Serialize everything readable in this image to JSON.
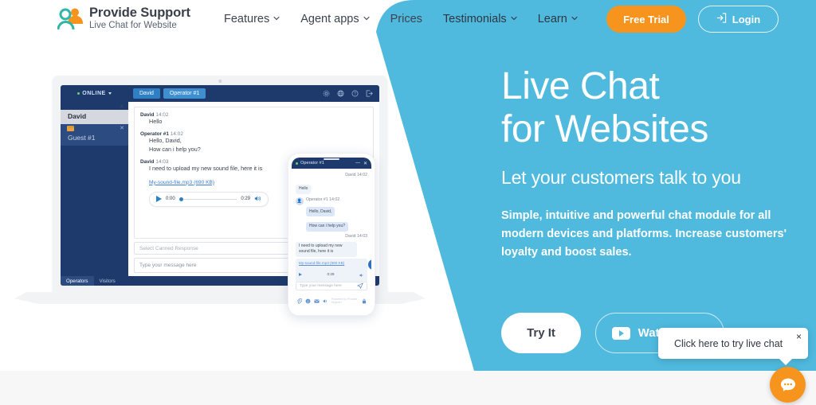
{
  "brand": {
    "name": "Provide Support",
    "tagline": "Live Chat for Website",
    "accent_orange": "#f7941e",
    "accent_blue": "#4fb9de",
    "dark_navy": "#1e3a6d"
  },
  "nav": {
    "items": [
      {
        "label": "Features",
        "has_caret": true
      },
      {
        "label": "Agent apps",
        "has_caret": true
      },
      {
        "label": "Prices",
        "has_caret": false
      },
      {
        "label": "Testimonials",
        "has_caret": true
      },
      {
        "label": "Learn",
        "has_caret": true
      }
    ],
    "free_trial_label": "Free Trial",
    "login_label": "Login"
  },
  "hero": {
    "heading_line1": "Live Chat",
    "heading_line2": "for Websites",
    "subheading": "Let your customers talk to you",
    "paragraph": "Simple, intuitive and powerful chat module for all modern devices and platforms. Increase customers' loyalty and boost sales.",
    "cta_primary": "Try It",
    "cta_secondary": "Watch video"
  },
  "chat_widget": {
    "tooltip_text": "Click here to try live chat",
    "close_label": "×"
  },
  "desktop_mock": {
    "status": "ONLINE",
    "tabs": [
      "David",
      "Operator #1"
    ],
    "visitor_list": [
      {
        "name": "David",
        "close": "✕",
        "selected": true
      },
      {
        "name": "Guest #1",
        "close": "✕",
        "selected": false
      }
    ],
    "messages": [
      {
        "author": "David",
        "time": "14:02",
        "lines": [
          "Hello"
        ]
      },
      {
        "author": "Operator #1",
        "time": "14:02",
        "lines": [
          "Hello, David,",
          "How can i help you?"
        ]
      },
      {
        "author": "David",
        "time": "14:03",
        "lines": [
          "I need to upload my new sound file, here it is"
        ]
      }
    ],
    "attachment_link": "My-sound-file.mp3 (690 KB)",
    "audio_current": "0:00",
    "audio_total": "0:29",
    "canned_placeholder": "Select Canned Response",
    "message_placeholder": "Type your message here",
    "footer_tabs": [
      "Operators",
      "Visitors"
    ]
  },
  "phone_mock": {
    "title": "Operator #1",
    "minimize": "—",
    "close": "✕",
    "messages": [
      {
        "author": "David",
        "time": "14:02",
        "side": "right",
        "lines": [
          "Hello"
        ]
      },
      {
        "author": "Operator #1",
        "time": "14:02",
        "side": "left",
        "lines": [
          "Hello, David,",
          "How can i help you?"
        ]
      },
      {
        "author": "David",
        "time": "14:03",
        "side": "right",
        "lines": [
          "I need to upload my new sound file, here it is"
        ]
      }
    ],
    "attachment_link": "My-sound-file.mp3 (690 KB)",
    "audio_total": "0:29",
    "message_placeholder": "Type your message here",
    "powered_by": "Powered by Provide Support"
  }
}
